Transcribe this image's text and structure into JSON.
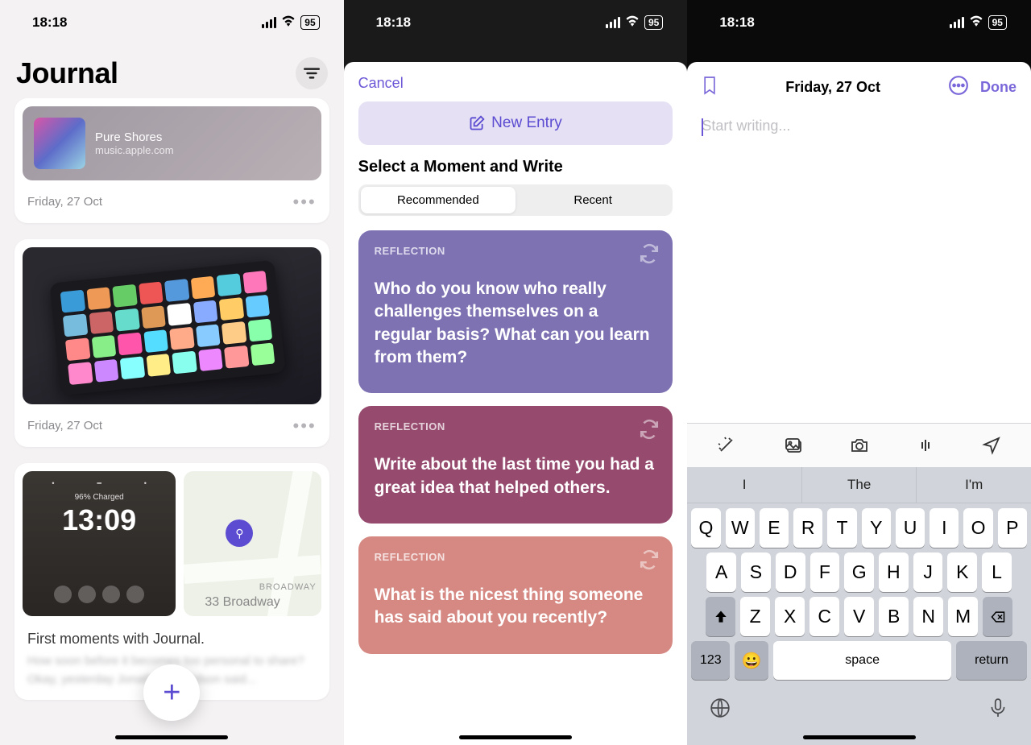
{
  "status": {
    "time": "18:18",
    "battery": "95"
  },
  "s1": {
    "title": "Journal",
    "music": {
      "title": "Pure Shores",
      "subtitle": "music.apple.com"
    },
    "card1_date": "Friday, 27 Oct",
    "card2_date": "Friday, 27 Oct",
    "lock": {
      "charge": "96% Charged",
      "time": "13:09"
    },
    "map": {
      "road": "BROADWAY",
      "addr": "33 Broadway"
    },
    "card3_title": "First moments with Journal.",
    "card3_body": "How soon before it becomes too personal to share? Okay, yesterday Jonathan Davidson said..."
  },
  "s2": {
    "cancel": "Cancel",
    "new_entry": "New Entry",
    "moment_title": "Select a Moment and Write",
    "seg": {
      "recommended": "Recommended",
      "recent": "Recent"
    },
    "tag": "REFLECTION",
    "p1": "Who do you know who really challenges themselves on a regular basis? What can you learn from them?",
    "p2": "Write about the last time you had a great idea that helped others.",
    "p3": "What is the nicest thing someone has said about you recently?"
  },
  "s3": {
    "date": "Friday, 27 Oct",
    "done": "Done",
    "placeholder": "Start writing...",
    "sugg": {
      "a": "I",
      "b": "The",
      "c": "I'm"
    },
    "row1": [
      "Q",
      "W",
      "E",
      "R",
      "T",
      "Y",
      "U",
      "I",
      "O",
      "P"
    ],
    "row2": [
      "A",
      "S",
      "D",
      "F",
      "G",
      "H",
      "J",
      "K",
      "L"
    ],
    "row3": [
      "Z",
      "X",
      "C",
      "V",
      "B",
      "N",
      "M"
    ],
    "k123": "123",
    "space": "space",
    "return": "return"
  }
}
